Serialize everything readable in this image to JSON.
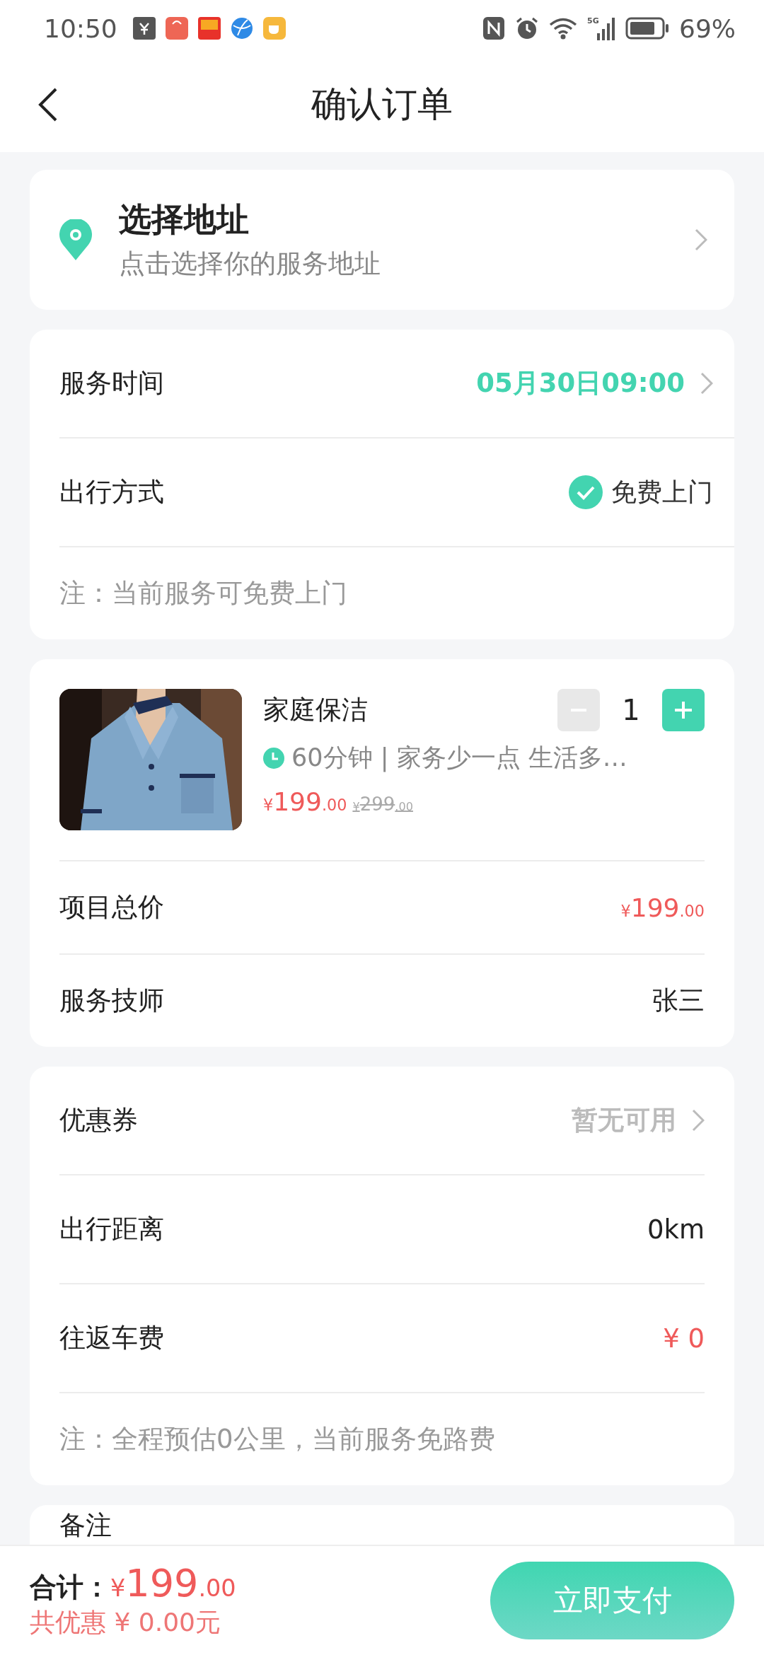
{
  "status_bar": {
    "time": "10:50",
    "battery": "69%",
    "network": "5G"
  },
  "header": {
    "title": "确认订单"
  },
  "address": {
    "title": "选择地址",
    "subtitle": "点击选择你的服务地址"
  },
  "service": {
    "rows": [
      {
        "kind": "link",
        "label": "服务时间",
        "value": "05月30日09:00",
        "color": "#43d4b0"
      },
      {
        "kind": "option",
        "label": "出行方式",
        "value": "免费上门",
        "checked": true
      },
      {
        "kind": "note",
        "label": "注：当前服务可免费上门"
      }
    ]
  },
  "order": {
    "product": {
      "kind": "picture",
      "title": "家庭保洁",
      "description": "60分钟 | 家务少一点 生活多…",
      "price": {
        "currency": "¥",
        "amount": "199",
        "cents": ".00"
      },
      "original_price": {
        "currency": "¥",
        "amount": "299",
        "cents": ".00"
      },
      "quantity": "1",
      "decrease_disabled": true
    },
    "rows": [
      {
        "kind": "price",
        "label": "项目总价",
        "price": {
          "currency": "¥",
          "amount": "199",
          "cents": ".00"
        }
      },
      {
        "kind": "value",
        "label": "服务技师",
        "value": "张三",
        "color": "#222222"
      }
    ]
  },
  "fees": {
    "rows": [
      {
        "kind": "link",
        "label": "优惠券",
        "value": "暂无可用",
        "color": "#bbbbbb"
      },
      {
        "kind": "value",
        "label": "出行距离",
        "value": "0km",
        "color": "#222222"
      },
      {
        "kind": "value",
        "label": "往返车费",
        "value": "¥ 0",
        "color": "#ef5a5a"
      },
      {
        "kind": "note",
        "label": "注：全程预估0公里，当前服务免路费"
      }
    ]
  },
  "remarks": {
    "label": "备注"
  },
  "footer": {
    "total_label": "合计：",
    "total": {
      "currency": "¥",
      "amount": "199",
      "cents": ".00"
    },
    "discount": "共优惠 ¥ 0.00元",
    "pay_button": "立即支付"
  }
}
